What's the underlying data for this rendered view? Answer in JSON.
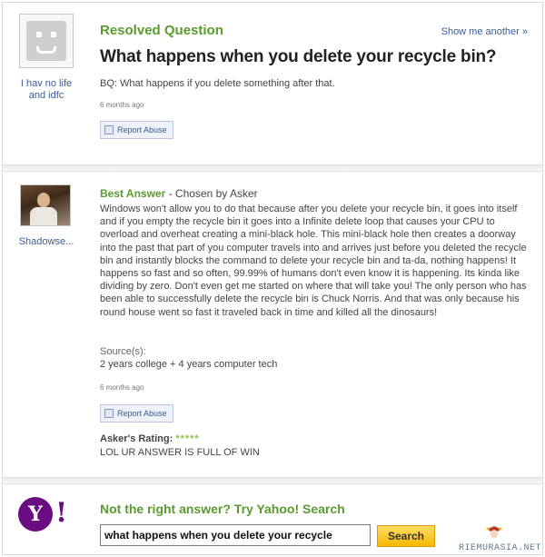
{
  "question": {
    "section_title": "Resolved Question",
    "show_another": "Show me another »",
    "title": "What happens when you delete your recycle bin?",
    "details": "BQ: What happens if you delete something after that.",
    "time": "6 months ago",
    "report": "Report Abuse",
    "asker": {
      "name": "I hav no life and idfc",
      "avatar_icon": "default-avatar-icon"
    }
  },
  "answer": {
    "best_label": "Best Answer",
    "chosen_by": " - Chosen by Asker",
    "answerer": "Shadowse...",
    "text": "Windows won't allow you to do that because after you delete your recycle bin, it goes into itself and if you empty the recycle bin it goes into a Infinite delete loop that causes your CPU to overload and overheat creating a mini-black hole. This mini-black hole then creates a doorway into the past that part of you computer travels into and arrives just before you deleted the recycle bin and instantly blocks the command to delete your recycle bin and ta-da, nothing happens! It happens so fast and so often, 99.99% of humans don't even know it is happening. Its kinda like dividing by zero. Don't even get me started on where that will take you! The only person who has been able to successfully delete the recycle bin is Chuck Norris. And that was only because his round house went so fast it traveled back in time and killed all the dinosaurs!",
    "sources_label": "Source(s):",
    "sources": "2 years college + 4 years computer tech",
    "time": "6 months ago",
    "report": "Report Abuse",
    "rating_label": "Asker's Rating:",
    "rating_stars": "*****",
    "rating_value": 5,
    "rating_comment": "LOL UR ANSWER IS FULL OF WIN"
  },
  "search": {
    "prompt": "Not the right answer? Try Yahoo! Search",
    "logo_text": "Y",
    "logo_bang": "!",
    "query": "what happens when you delete your recycle",
    "button": "Search"
  },
  "watermark": "RIEMURASIA.NET",
  "colors": {
    "accent_green": "#5a9a2f",
    "link_blue": "#3a5c96",
    "yahoo_purple": "#6a0d82",
    "search_button": "#f5b800"
  }
}
